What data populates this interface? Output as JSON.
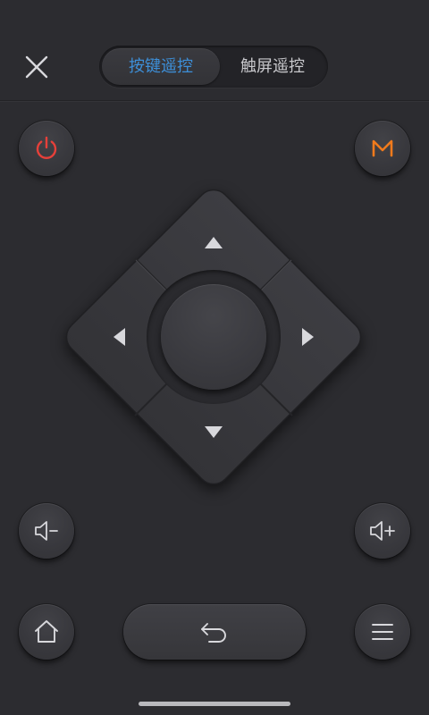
{
  "header": {
    "close_icon": "close-icon",
    "tabs": [
      {
        "label": "按键遥控",
        "active": true
      },
      {
        "label": "触屏遥控",
        "active": false
      }
    ]
  },
  "buttons": {
    "power_icon": "power-icon",
    "menu_m_label": "M",
    "up_icon": "arrow-up-icon",
    "down_icon": "arrow-down-icon",
    "left_icon": "arrow-left-icon",
    "right_icon": "arrow-right-icon",
    "ok_icon": "ok-button",
    "volume_down_icon": "volume-down-icon",
    "volume_up_icon": "volume-up-icon",
    "home_icon": "home-icon",
    "back_icon": "back-icon",
    "menu_icon": "menu-icon"
  },
  "colors": {
    "background": "#2c2c30",
    "active_tab_text": "#3d8fd8",
    "inactive_tab_text": "#c8c8cc",
    "power_red": "#e6403a",
    "m_orange": "#f07a1c",
    "icon_light": "#d8d8dc"
  }
}
